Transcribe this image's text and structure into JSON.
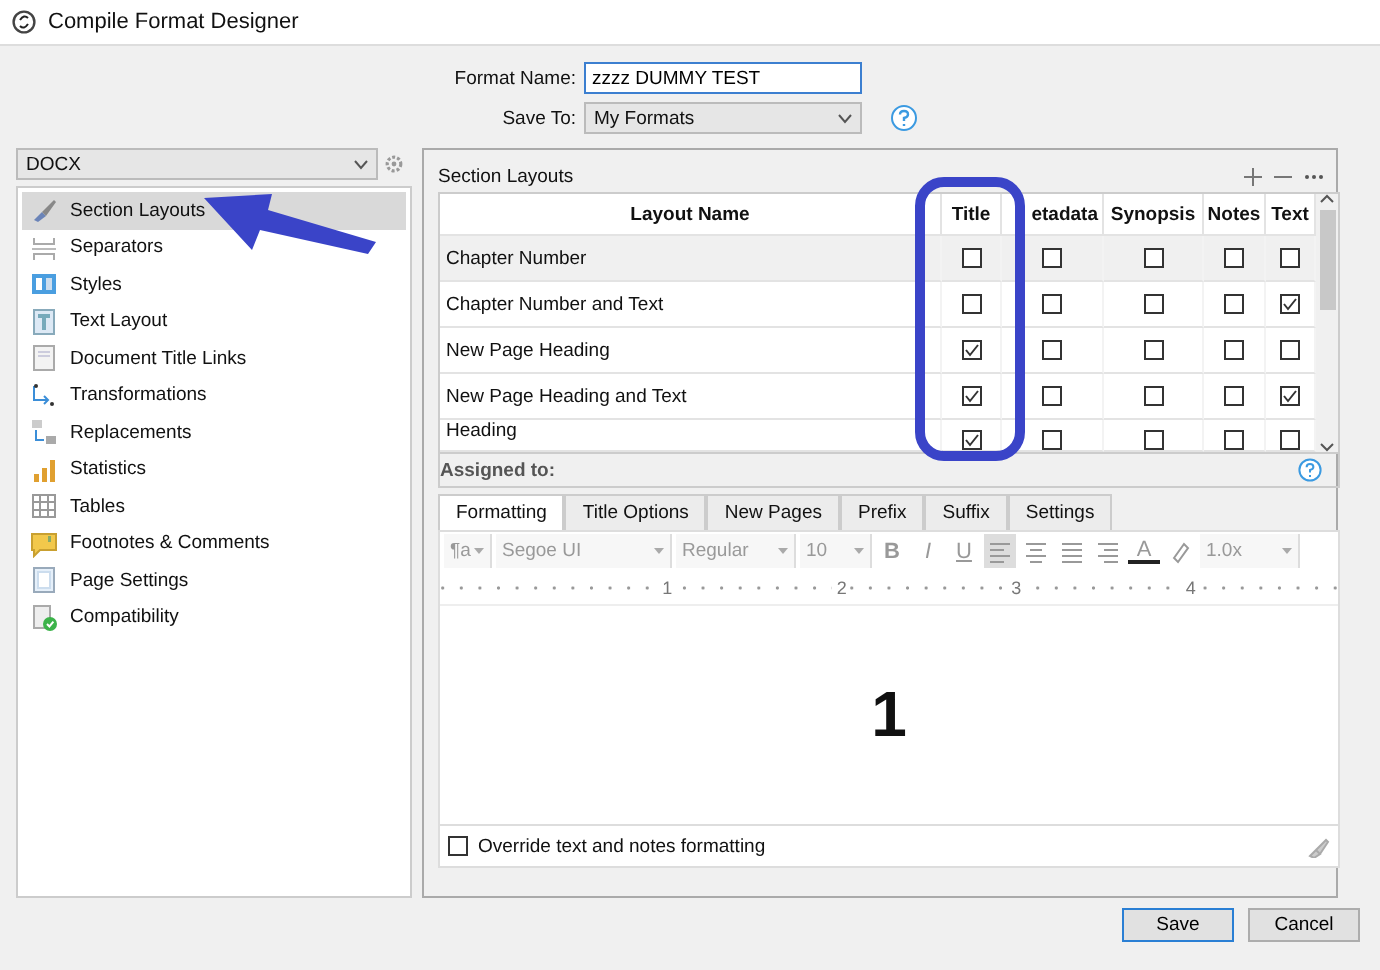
{
  "window": {
    "title": "Compile Format Designer"
  },
  "format_name": {
    "label": "Format Name:",
    "value": "zzzz DUMMY TEST"
  },
  "save_to": {
    "label": "Save To:",
    "value": "My Formats"
  },
  "output_format": {
    "value": "DOCX"
  },
  "sidebar": {
    "items": [
      {
        "label": "Section Layouts",
        "selected": true
      },
      {
        "label": "Separators",
        "selected": false
      },
      {
        "label": "Styles",
        "selected": false
      },
      {
        "label": "Text Layout",
        "selected": false
      },
      {
        "label": "Document Title Links",
        "selected": false
      },
      {
        "label": "Transformations",
        "selected": false
      },
      {
        "label": "Replacements",
        "selected": false
      },
      {
        "label": "Statistics",
        "selected": false
      },
      {
        "label": "Tables",
        "selected": false
      },
      {
        "label": "Footnotes & Comments",
        "selected": false
      },
      {
        "label": "Page Settings",
        "selected": false
      },
      {
        "label": "Compatibility",
        "selected": false
      }
    ]
  },
  "section_layouts": {
    "title": "Section Layouts",
    "columns": [
      "Layout Name",
      "Title",
      "etadata",
      "Synopsis",
      "Notes",
      "Text"
    ],
    "rows": [
      {
        "name": "Chapter Number",
        "selected": true,
        "checks": [
          false,
          false,
          false,
          false,
          false
        ]
      },
      {
        "name": "Chapter Number and Text",
        "selected": false,
        "checks": [
          false,
          false,
          false,
          false,
          true
        ]
      },
      {
        "name": "New Page Heading",
        "selected": false,
        "checks": [
          true,
          false,
          false,
          false,
          false
        ]
      },
      {
        "name": "New Page Heading and Text",
        "selected": false,
        "checks": [
          true,
          false,
          false,
          false,
          true
        ]
      },
      {
        "name": "Heading",
        "selected": false,
        "checks": [
          true,
          false,
          false,
          false,
          false
        ]
      }
    ]
  },
  "assigned_to": {
    "label": "Assigned to:"
  },
  "tabs": [
    {
      "label": "Formatting",
      "selected": true
    },
    {
      "label": "Title Options",
      "selected": false
    },
    {
      "label": "New Pages",
      "selected": false
    },
    {
      "label": "Prefix",
      "selected": false
    },
    {
      "label": "Suffix",
      "selected": false
    },
    {
      "label": "Settings",
      "selected": false
    }
  ],
  "toolbar": {
    "style": "¶a",
    "font": "Segoe UI",
    "weight": "Regular",
    "size": "10",
    "bold": "B",
    "italic": "I",
    "underline": "U",
    "text_color": "A",
    "spacing": "1.0x",
    "alignment": [
      {
        "selected": true
      },
      {
        "selected": false
      },
      {
        "selected": false
      },
      {
        "selected": false
      }
    ]
  },
  "ruler": [
    "1",
    "2",
    "3",
    "4"
  ],
  "editor": {
    "text": "1"
  },
  "override": {
    "label": "Override text and notes formatting",
    "checked": false
  },
  "buttons": [
    {
      "label": "Save",
      "default": true
    },
    {
      "label": "Cancel",
      "default": false
    }
  ]
}
